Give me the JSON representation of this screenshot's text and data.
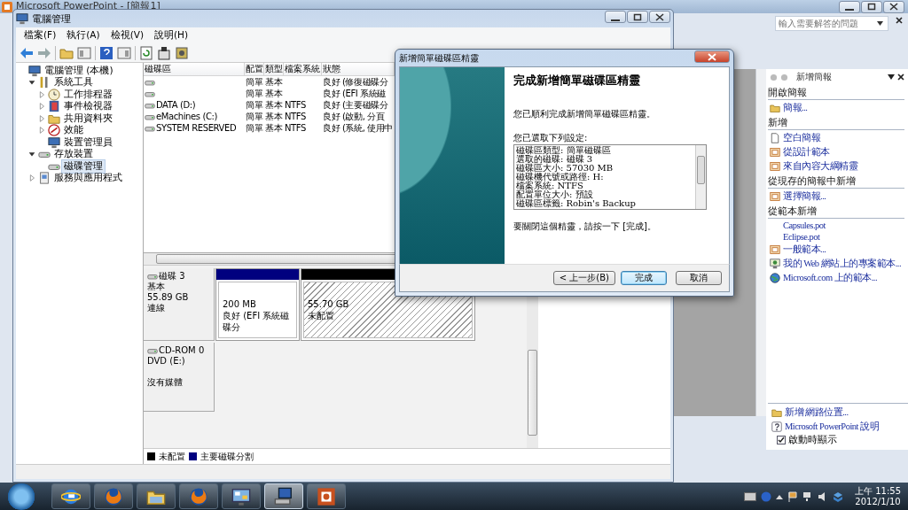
{
  "powerpoint": {
    "title": "Microsoft PowerPoint - [簡報1]",
    "help_box": {
      "placeholder": "輸入需要解答的問題"
    },
    "task_pane": {
      "title": "新增簡報",
      "sections": [
        {
          "heading": "開啟簡報",
          "items": [
            {
              "label": "簡報...",
              "kind": "folder"
            }
          ]
        },
        {
          "heading": "新增",
          "items": [
            {
              "label": "空白簡報",
              "kind": "page"
            },
            {
              "label": "從設計範本",
              "kind": "slide"
            },
            {
              "label": "來自內容大綱精靈",
              "kind": "slide"
            }
          ]
        },
        {
          "heading": "從現存的簡報中新增",
          "items": [
            {
              "label": "選擇簡報...",
              "kind": "slide"
            }
          ]
        },
        {
          "heading": "從範本新增",
          "items": [
            {
              "label": "Capsules.pot",
              "kind": "plain"
            },
            {
              "label": "Eclipse.pot",
              "kind": "plain"
            },
            {
              "label": "一般範本...",
              "kind": "slide"
            },
            {
              "label": "我的 Web 網站上的專案範本...",
              "kind": "monitor"
            },
            {
              "label": "Microsoft.com 上的範本...",
              "kind": "globe"
            }
          ]
        }
      ],
      "footer_links": [
        {
          "label": "新增 網路位置...",
          "kind": "folder"
        },
        {
          "label": "Microsoft PowerPoint 說明",
          "kind": "help"
        }
      ],
      "show_at_startup": {
        "label": "啟動時顯示",
        "checked": true
      }
    }
  },
  "computer_management": {
    "title": "電腦管理",
    "menu": [
      "檔案(F)",
      "執行(A)",
      "檢視(V)",
      "說明(H)"
    ],
    "tree": [
      {
        "label": "電腦管理 (本機)",
        "kind": "computer",
        "selected": false,
        "children": [
          {
            "label": "系統工具",
            "kind": "tools",
            "expanded": true,
            "selected": false,
            "children": [
              {
                "label": "工作排程器",
                "kind": "clock",
                "expanded": false,
                "selected": false
              },
              {
                "label": "事件檢視器",
                "kind": "book",
                "expanded": false,
                "selected": false
              },
              {
                "label": "共用資料夾",
                "kind": "folder",
                "expanded": false,
                "selected": false
              },
              {
                "label": "效能",
                "kind": "gauge",
                "expanded": false,
                "selected": false
              },
              {
                "label": "裝置管理員",
                "kind": "computer",
                "selected": false
              }
            ]
          },
          {
            "label": "存放裝置",
            "kind": "drive",
            "expanded": true,
            "selected": false,
            "children": [
              {
                "label": "磁碟管理",
                "kind": "drive",
                "selected": true
              }
            ]
          },
          {
            "label": "服務與應用程式",
            "kind": "services",
            "expanded": false,
            "selected": false
          }
        ]
      }
    ],
    "volumes": {
      "columns": [
        "磁碟區",
        "配置",
        "類型",
        "檔案系統",
        "狀態"
      ],
      "rows": [
        {
          "layout": "簡單",
          "type": "基本",
          "status": "良好 (修復磁碟分"
        },
        {
          "layout": "簡單",
          "type": "基本",
          "status": "良好 (EFI 系統磁"
        },
        {
          "volume": "DATA (D:)",
          "layout": "簡單",
          "type": "基本",
          "file_system": "NTFS",
          "status": "良好 (主要磁碟分"
        },
        {
          "volume": "eMachines (C:)",
          "layout": "簡單",
          "type": "基本",
          "file_system": "NTFS",
          "status": "良好 (啟動, 分頁"
        },
        {
          "volume": "SYSTEM RESERVED",
          "layout": "簡單",
          "type": "基本",
          "file_system": "NTFS",
          "status": "良好 (系統, 使用中"
        }
      ]
    },
    "disks": [
      {
        "kind": "disk",
        "name": "磁碟 3",
        "type": "基本",
        "capacity": "55.89 GB",
        "state": "連線",
        "partitions": [
          {
            "kind": "primary",
            "size": "200 MB",
            "status": "良好 (EFI 系統磁碟分",
            "color": "#00007f"
          },
          {
            "kind": "unallocated",
            "size": "55.70 GB",
            "status": "未配置",
            "color": "#000000"
          }
        ]
      },
      {
        "kind": "cdrom",
        "name": "CD-ROM 0",
        "drive": "DVD (E:)",
        "media": "沒有媒體"
      }
    ],
    "legend": [
      {
        "label": "未配置",
        "color": "#000000"
      },
      {
        "label": "主要磁碟分割",
        "color": "#00007f"
      }
    ]
  },
  "wizard": {
    "title": "新增簡單磁碟區精靈",
    "heading": "完成新增簡單磁碟區精靈",
    "intro": "您已順利完成新增簡單磁碟區精靈。",
    "settings_label": "您已選取下列設定:",
    "settings": [
      "磁碟區類型: 簡單磁碟區",
      "選取的磁碟: 磁碟 3",
      "磁碟區大小: 57030 MB",
      "磁碟機代號或路徑: H:",
      "檔案系統: NTFS",
      "配置單位大小: 預設",
      "磁碟區標籤: Robin's Backup"
    ],
    "closing": "要關閉這個精靈，請按一下 [完成]。",
    "buttons": [
      {
        "label": "< 上一步(B)",
        "default": false
      },
      {
        "label": "完成",
        "default": true
      },
      {
        "label": "取消",
        "default": false
      }
    ]
  },
  "taskbar": {
    "apps": [
      {
        "kind": "browser-e",
        "selected": false
      },
      {
        "kind": "browser-fox",
        "selected": false
      },
      {
        "kind": "explorer",
        "selected": false
      },
      {
        "kind": "browser-fox",
        "selected": false
      },
      {
        "kind": "control",
        "selected": false
      },
      {
        "kind": "network",
        "selected": true
      },
      {
        "kind": "presentation",
        "selected": false
      }
    ],
    "clock": {
      "time": "上午 11:55",
      "date": "2012/1/10"
    }
  }
}
